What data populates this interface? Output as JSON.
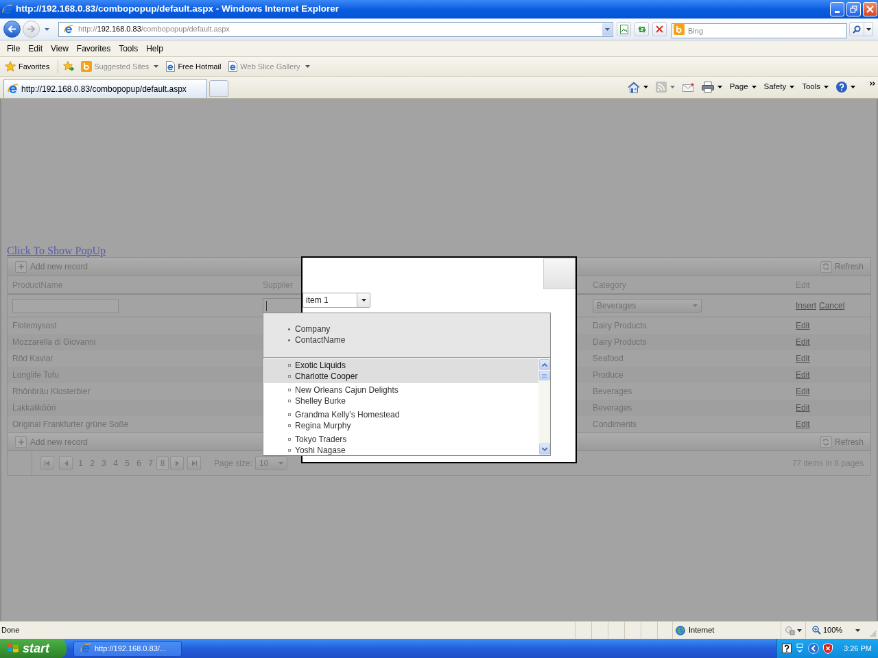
{
  "window": {
    "title": "http://192.168.0.83/combopopup/default.aspx - Windows Internet Explorer"
  },
  "address_bar": {
    "back": {
      "disabled": false
    },
    "forward": {
      "disabled": true
    },
    "url": {
      "scheme": "http://",
      "host": "192.168.0.83",
      "path": "/combopopup/default.aspx"
    }
  },
  "search": {
    "placeholder": "Bing"
  },
  "menu": [
    "File",
    "Edit",
    "View",
    "Favorites",
    "Tools",
    "Help"
  ],
  "favorites_bar": {
    "label": "Favorites",
    "items": [
      {
        "kind": "bing",
        "label": "Suggested Sites",
        "disabled": true,
        "has_menu": true
      },
      {
        "kind": "page",
        "label": "Free Hotmail",
        "disabled": false,
        "has_menu": false
      },
      {
        "kind": "page",
        "label": "Web Slice Gallery",
        "disabled": true,
        "has_menu": true
      }
    ]
  },
  "tabs": [
    {
      "label": "http://192.168.0.83/combopopup/default.aspx",
      "selected": true
    }
  ],
  "command_bar": [
    {
      "kind": "home",
      "has_menu": true,
      "disabled": false
    },
    {
      "kind": "feeds",
      "has_menu": true,
      "disabled": true
    },
    {
      "kind": "mail",
      "has_menu": false,
      "disabled": false
    },
    {
      "kind": "print",
      "has_menu": true,
      "disabled": false
    },
    {
      "kind": "text",
      "label": "Page",
      "has_menu": true,
      "disabled": false
    },
    {
      "kind": "text",
      "label": "Safety",
      "has_menu": true,
      "disabled": false
    },
    {
      "kind": "text",
      "label": "Tools",
      "has_menu": true,
      "disabled": false
    },
    {
      "kind": "help",
      "has_menu": true,
      "disabled": false
    }
  ],
  "page": {
    "link": "Click To Show PopUp",
    "grid": {
      "toolbar": {
        "add": "Add new record",
        "refresh": "Refresh"
      },
      "columns": [
        "ProductName",
        "Supplier",
        "Category",
        "Edit"
      ],
      "insert_row": {
        "category": "Beverages",
        "actions": [
          "Insert",
          "Cancel"
        ],
        "supplier_dropdown": {
          "columns": [
            "Company",
            "ContactName"
          ],
          "items": [
            {
              "company": "Exotic Liquids",
              "contact": "Charlotte Cooper",
              "selected": true
            },
            {
              "company": "New Orleans Cajun Delights",
              "contact": "Shelley Burke",
              "selected": false
            },
            {
              "company": "Grandma Kelly's Homestead",
              "contact": "Regina Murphy",
              "selected": false
            },
            {
              "company": "Tokyo Traders",
              "contact": "Yoshi Nagase",
              "selected": false
            }
          ]
        }
      },
      "rows": [
        {
          "product": "Flotemysost",
          "category": "Dairy Products",
          "action": "Edit"
        },
        {
          "product": "Mozzarella di Giovanni",
          "category": "Dairy Products",
          "action": "Edit"
        },
        {
          "product": "Röd Kaviar",
          "category": "Seafood",
          "action": "Edit"
        },
        {
          "product": "Longlife Tofu",
          "category": "Produce",
          "action": "Edit"
        },
        {
          "product": "Rhönbräu Klosterbier",
          "category": "Beverages",
          "action": "Edit"
        },
        {
          "product": "Lakkalikööri",
          "category": "Beverages",
          "action": "Edit"
        },
        {
          "product": "Original Frankfurter grüne Soße",
          "category": "Condiments",
          "action": "Edit"
        }
      ],
      "footer_toolbar": {
        "add": "Add new record",
        "refresh": "Refresh"
      },
      "pager": {
        "pages": [
          {
            "label": "1",
            "selected": false
          },
          {
            "label": "2",
            "selected": false
          },
          {
            "label": "3",
            "selected": false
          },
          {
            "label": "4",
            "selected": false
          },
          {
            "label": "5",
            "selected": false
          },
          {
            "label": "6",
            "selected": false
          },
          {
            "label": "7",
            "selected": false
          },
          {
            "label": "8",
            "selected": true
          }
        ],
        "page_size_label": "Page size:",
        "page_size": "10",
        "summary": "77 items in 8 pages"
      }
    },
    "popup": {
      "select": {
        "value": "item 1"
      }
    }
  },
  "status_bar": {
    "text": "Done",
    "zone": "Internet",
    "zoom": "100%"
  },
  "taskbar": {
    "start": "start",
    "tasks": [
      "http://192.168.0.83/..."
    ],
    "clock": "3:26 PM"
  }
}
